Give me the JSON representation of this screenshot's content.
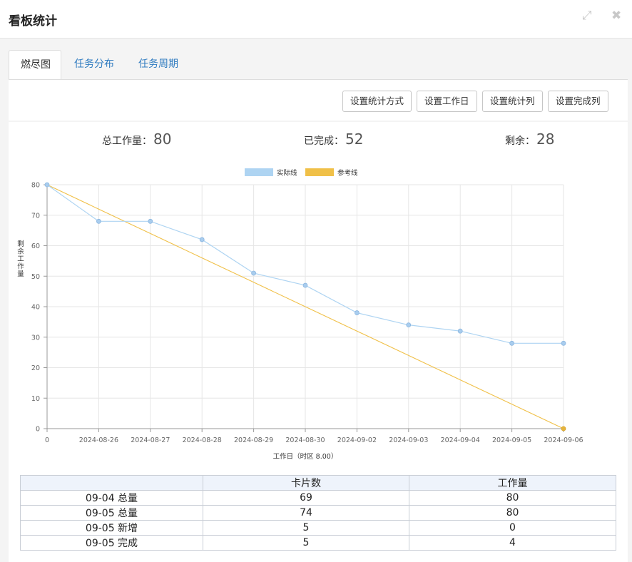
{
  "window": {
    "title": "看板统计",
    "maximize_icon": "maximize-icon",
    "close_icon": "close-icon"
  },
  "tabs": [
    {
      "label": "燃尽图",
      "active": true
    },
    {
      "label": "任务分布",
      "active": false
    },
    {
      "label": "任务周期",
      "active": false
    }
  ],
  "toolbar": {
    "buttons": [
      "设置统计方式",
      "设置工作日",
      "设置统计列",
      "设置完成列"
    ]
  },
  "summary": {
    "total_label": "总工作量：",
    "total_value": "80",
    "done_label": "已完成：",
    "done_value": "52",
    "remaining_label": "剩余：",
    "remaining_value": "28"
  },
  "chart_data": {
    "type": "line",
    "categories": [
      "0",
      "2024-08-26",
      "2024-08-27",
      "2024-08-28",
      "2024-08-29",
      "2024-08-30",
      "2024-09-02",
      "2024-09-03",
      "2024-09-04",
      "2024-09-05",
      "2024-09-06"
    ],
    "series": [
      {
        "name": "实际线",
        "color": "#aed4f2",
        "values": [
          80,
          68,
          68,
          62,
          51,
          47,
          38,
          34,
          32,
          28,
          28
        ]
      },
      {
        "name": "参考线",
        "color": "#f0c048",
        "values": [
          80,
          72,
          64,
          56,
          48,
          40,
          32,
          24,
          16,
          8,
          0
        ]
      }
    ],
    "xlabel": "工作日（时区 8.00）",
    "ylabel": "剩余工作量",
    "ylim": [
      0,
      80
    ],
    "yticks": [
      0,
      10,
      20,
      30,
      40,
      50,
      60,
      70,
      80
    ],
    "grid": true,
    "legend": "top-center"
  },
  "table": {
    "headers": [
      "",
      "卡片数",
      "工作量"
    ],
    "rows": [
      [
        "09-04 总量",
        "69",
        "80"
      ],
      [
        "09-05 总量",
        "74",
        "80"
      ],
      [
        "09-05 新增",
        "5",
        "0"
      ],
      [
        "09-05 完成",
        "5",
        "4"
      ]
    ]
  }
}
